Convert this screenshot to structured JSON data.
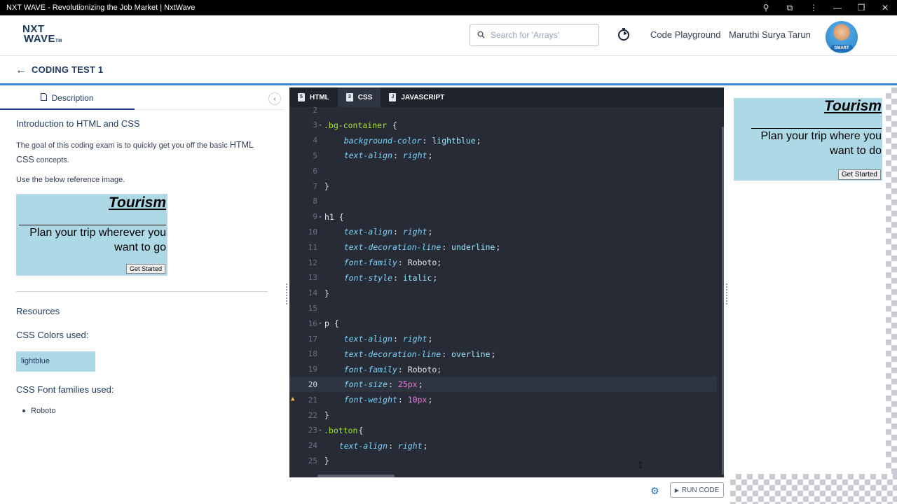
{
  "window": {
    "title": "NXT WAVE - Revolutionizing the Job Market | NxtWave",
    "controls": {
      "zoom_icon": "⚲",
      "extensions_icon": "⧉",
      "menu_icon": "⋮",
      "minimize": "—",
      "restore": "❐",
      "close": "✕"
    }
  },
  "topnav": {
    "logo_line1": "NXT",
    "logo_line2": "WAVE",
    "logo_tm": "TM",
    "search_placeholder": "Search for 'Arrays'",
    "code_playground": "Code Playground",
    "user_name": "Maruthi Surya Tarun",
    "avatar_badge": "SMART"
  },
  "breadcrumb": {
    "back_icon": "←",
    "title": "CODING TEST 1"
  },
  "left_panel": {
    "tab_label": "Description",
    "collapse_icon": "‹",
    "heading": "Introduction to HTML and CSS",
    "intro_prefix": "The goal of this coding exam is to quickly get you off the basic ",
    "intro_highlight1": "HTML",
    "intro_and": "and ",
    "intro_highlight2": "CSS",
    "intro_suffix": " concepts.",
    "ref_label": "Use the below reference image.",
    "reference": {
      "title": "Tourism",
      "paragraph": "Plan your trip wherever you want to go",
      "button": "Get Started"
    },
    "resources_heading": "Resources",
    "colors_heading": "CSS Colors used:",
    "color_swatch": "lightblue",
    "fonts_heading": "CSS Font families used:",
    "font_item": "Roboto"
  },
  "editor": {
    "tabs": [
      "HTML",
      "CSS",
      "JAVASCRIPT"
    ],
    "active_tab": "CSS",
    "highlighted_line": 20,
    "warning_line": 21,
    "lines": [
      {
        "n": "2",
        "fold": false,
        "tokens": []
      },
      {
        "n": "3",
        "fold": true,
        "tokens": [
          [
            "sel",
            ".bg-container"
          ],
          [
            "txt",
            " {"
          ]
        ]
      },
      {
        "n": "4",
        "fold": false,
        "tokens": [
          [
            "txt",
            "    "
          ],
          [
            "prop",
            "background-color"
          ],
          [
            "txt",
            ": "
          ],
          [
            "val",
            "lightblue"
          ],
          [
            "txt",
            ";"
          ]
        ]
      },
      {
        "n": "5",
        "fold": false,
        "tokens": [
          [
            "txt",
            "    "
          ],
          [
            "prop",
            "text-align"
          ],
          [
            "txt",
            ": "
          ],
          [
            "prop",
            "right"
          ],
          [
            "txt",
            ";"
          ]
        ]
      },
      {
        "n": "6",
        "fold": false,
        "tokens": []
      },
      {
        "n": "7",
        "fold": false,
        "tokens": [
          [
            "txt",
            "}"
          ]
        ]
      },
      {
        "n": "8",
        "fold": false,
        "tokens": []
      },
      {
        "n": "9",
        "fold": true,
        "tokens": [
          [
            "txt",
            "h1 {"
          ]
        ]
      },
      {
        "n": "10",
        "fold": false,
        "tokens": [
          [
            "txt",
            "    "
          ],
          [
            "prop",
            "text-align"
          ],
          [
            "txt",
            ": "
          ],
          [
            "prop",
            "right"
          ],
          [
            "txt",
            ";"
          ]
        ]
      },
      {
        "n": "11",
        "fold": false,
        "tokens": [
          [
            "txt",
            "    "
          ],
          [
            "prop",
            "text-decoration-line"
          ],
          [
            "txt",
            ": "
          ],
          [
            "val",
            "underline"
          ],
          [
            "txt",
            ";"
          ]
        ]
      },
      {
        "n": "12",
        "fold": false,
        "tokens": [
          [
            "txt",
            "    "
          ],
          [
            "prop",
            "font-family"
          ],
          [
            "txt",
            ": Roboto;"
          ]
        ]
      },
      {
        "n": "13",
        "fold": false,
        "tokens": [
          [
            "txt",
            "    "
          ],
          [
            "prop",
            "font-style"
          ],
          [
            "txt",
            ": "
          ],
          [
            "val",
            "italic"
          ],
          [
            "txt",
            ";"
          ]
        ]
      },
      {
        "n": "14",
        "fold": false,
        "tokens": [
          [
            "txt",
            "}"
          ]
        ]
      },
      {
        "n": "15",
        "fold": false,
        "tokens": []
      },
      {
        "n": "16",
        "fold": true,
        "tokens": [
          [
            "txt",
            "p {"
          ]
        ]
      },
      {
        "n": "17",
        "fold": false,
        "tokens": [
          [
            "txt",
            "    "
          ],
          [
            "prop",
            "text-align"
          ],
          [
            "txt",
            ": "
          ],
          [
            "prop",
            "right"
          ],
          [
            "txt",
            ";"
          ]
        ]
      },
      {
        "n": "18",
        "fold": false,
        "tokens": [
          [
            "txt",
            "    "
          ],
          [
            "prop",
            "text-decoration-line"
          ],
          [
            "txt",
            ": "
          ],
          [
            "val",
            "overline"
          ],
          [
            "txt",
            ";"
          ]
        ]
      },
      {
        "n": "19",
        "fold": false,
        "tokens": [
          [
            "txt",
            "    "
          ],
          [
            "prop",
            "font-family"
          ],
          [
            "txt",
            ": Roboto;"
          ]
        ]
      },
      {
        "n": "20",
        "fold": false,
        "tokens": [
          [
            "txt",
            "    "
          ],
          [
            "prop",
            "font-size"
          ],
          [
            "txt",
            ": "
          ],
          [
            "num",
            "25"
          ],
          [
            "unit",
            "px"
          ],
          [
            "txt",
            ";"
          ]
        ]
      },
      {
        "n": "21",
        "fold": false,
        "tokens": [
          [
            "txt",
            "    "
          ],
          [
            "prop",
            "font-weight"
          ],
          [
            "txt",
            ": "
          ],
          [
            "num",
            "10"
          ],
          [
            "unit",
            "px"
          ],
          [
            "txt",
            ";"
          ]
        ]
      },
      {
        "n": "22",
        "fold": false,
        "tokens": [
          [
            "txt",
            "}"
          ]
        ]
      },
      {
        "n": "23",
        "fold": true,
        "tokens": [
          [
            "sel",
            ".botton"
          ],
          [
            "txt",
            "{"
          ]
        ]
      },
      {
        "n": "24",
        "fold": false,
        "tokens": [
          [
            "txt",
            "   "
          ],
          [
            "prop",
            "text-align"
          ],
          [
            "txt",
            ": "
          ],
          [
            "prop",
            "right"
          ],
          [
            "txt",
            ";"
          ]
        ]
      },
      {
        "n": "25",
        "fold": false,
        "tokens": [
          [
            "txt",
            "}"
          ]
        ]
      }
    ]
  },
  "preview": {
    "title": "Tourism",
    "paragraph": "Plan your trip where you want to do",
    "button": "Get Started"
  },
  "footer": {
    "run_label": "RUN CODE",
    "settings_icon": "⚙"
  }
}
